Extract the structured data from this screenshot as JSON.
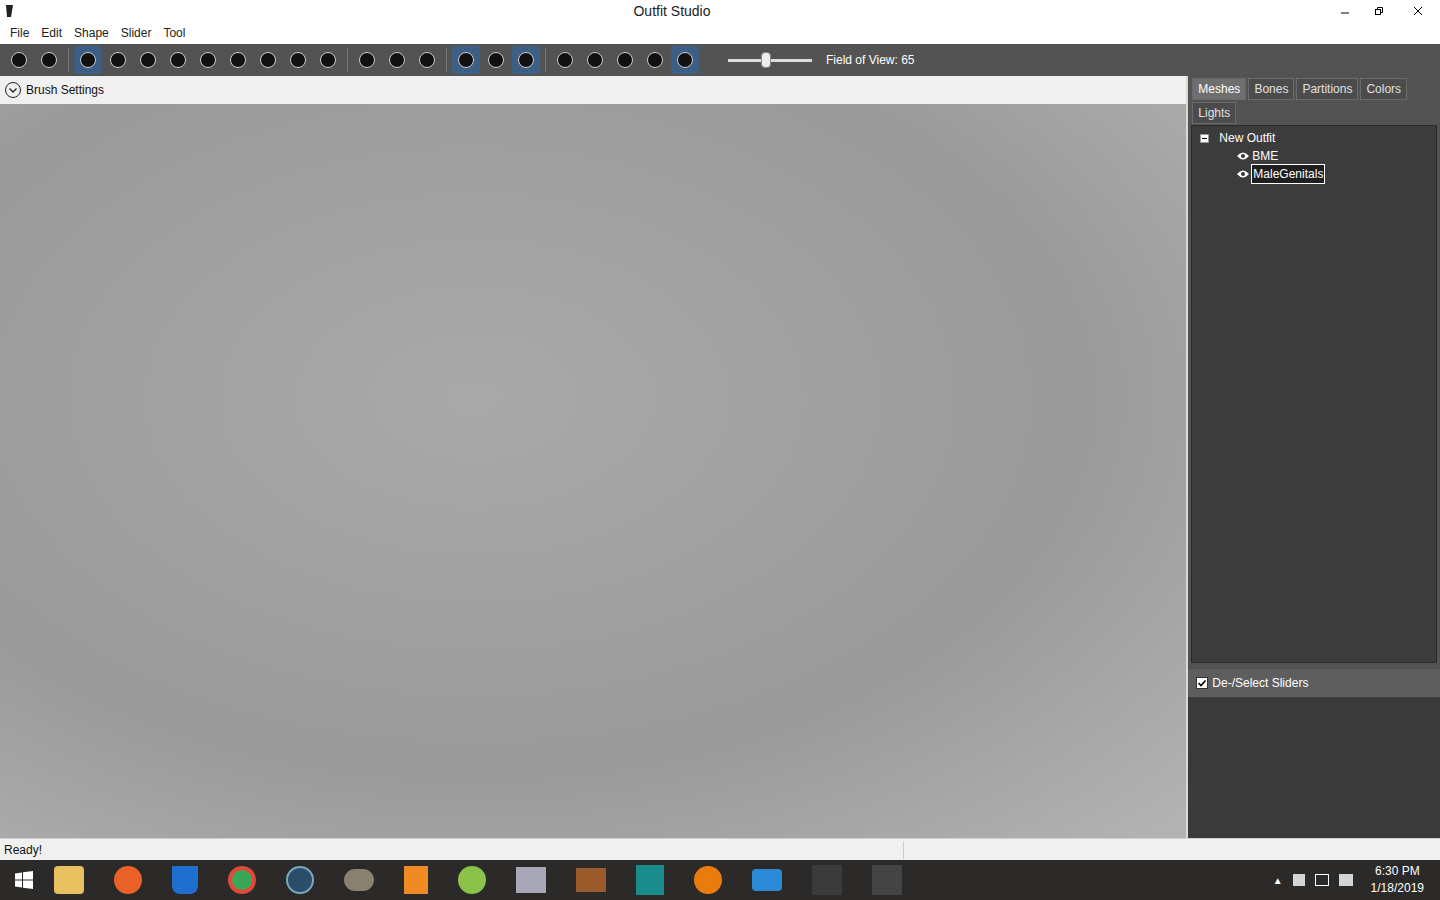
{
  "window": {
    "title": "Outfit Studio"
  },
  "menu": [
    "File",
    "Edit",
    "Shape",
    "Slider",
    "Tool"
  ],
  "toolbar": {
    "groups": [
      [
        {
          "selected": false
        },
        {
          "selected": false
        }
      ],
      [
        {
          "selected": true
        },
        {
          "selected": false
        },
        {
          "selected": false
        },
        {
          "selected": false
        },
        {
          "selected": false
        },
        {
          "selected": false
        },
        {
          "selected": false
        },
        {
          "selected": false
        },
        {
          "selected": false
        }
      ],
      [
        {
          "selected": false
        },
        {
          "selected": false
        },
        {
          "selected": false
        }
      ],
      [
        {
          "selected": true
        },
        {
          "selected": false
        },
        {
          "selected": true
        }
      ],
      [
        {
          "selected": false
        },
        {
          "selected": false
        },
        {
          "selected": false
        },
        {
          "selected": false
        },
        {
          "selected": true
        }
      ]
    ],
    "fov_slider": {
      "level": 0.45
    },
    "fov_label": "Field of View: 65"
  },
  "brush_settings": {
    "label": "Brush Settings"
  },
  "panel": {
    "tabs": [
      {
        "label": "Meshes",
        "selected": true
      },
      {
        "label": "Bones",
        "selected": false
      },
      {
        "label": "Partitions",
        "selected": false
      },
      {
        "label": "Colors",
        "selected": false
      },
      {
        "label": "Lights",
        "selected": false
      }
    ],
    "tree": {
      "label": "New Outfit",
      "expanded": true,
      "children": [
        {
          "label": "BME",
          "visible": true,
          "selected": false
        },
        {
          "label": "MaleGenitals",
          "visible": true,
          "selected": true
        }
      ]
    },
    "sliders": {
      "label": "De-/Select Sliders",
      "checked": true
    }
  },
  "status_bar": "Ready!",
  "taskbar": {
    "time": "6:30 PM",
    "date": "1/18/2019"
  }
}
